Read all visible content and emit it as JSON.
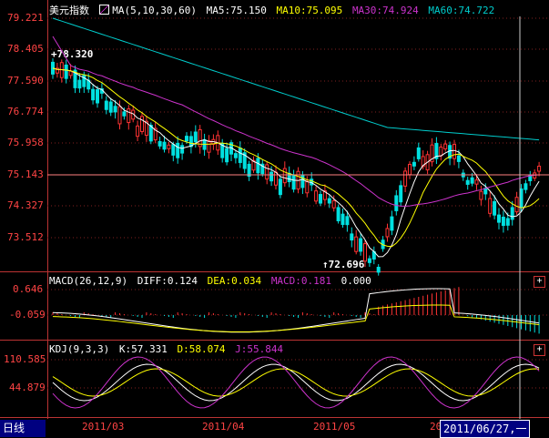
{
  "main_panel": {
    "title": "美元指数",
    "ma_param_label": "MA(5,10,30,60)",
    "ma5_label": "MA5:75.150",
    "ma10_label": "MA10:75.095",
    "ma30_label": "MA30:74.924",
    "ma60_label": "MA60:74.722",
    "y_ticks": [
      "79.221",
      "78.405",
      "77.590",
      "76.774",
      "75.958",
      "75.143",
      "74.327",
      "73.512"
    ],
    "high_annotation": "78.320",
    "low_annotation": "72.696"
  },
  "macd_panel": {
    "param_label": "MACD(26,12,9)",
    "diff_label": "DIFF:0.124",
    "dea_label": "DEA:0.034",
    "macd_label": "MACD:0.181",
    "extra_value": "0.000",
    "y_ticks": [
      "0.646",
      "-0.059"
    ]
  },
  "kdj_panel": {
    "param_label": "KDJ(9,3,3)",
    "k_label": "K:57.331",
    "d_label": "D:58.074",
    "j_label": "J:55.844",
    "y_ticks": [
      "110.585",
      "44.879"
    ]
  },
  "x_axis": {
    "period_button": "日线",
    "labels": [
      "2011/03",
      "2011/04",
      "2011/05",
      "20"
    ],
    "cursor_date": "2011/06/27,一"
  },
  "maximize_symbol": "+",
  "colors": {
    "up": "#ff3333",
    "down": "#00e0e0",
    "ma5": "#ffffff",
    "ma10": "#ffff00",
    "ma30": "#cc33cc",
    "ma60": "#00cccc",
    "grid": "#b33333"
  }
}
